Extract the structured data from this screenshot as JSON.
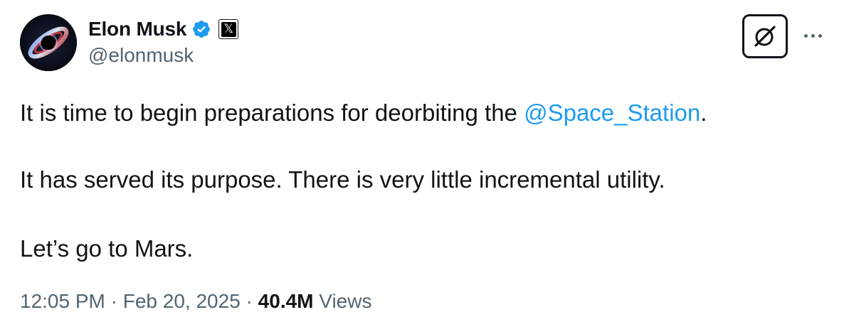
{
  "author": {
    "display_name": "Elon Musk",
    "handle": "@elonmusk",
    "verified": true,
    "verified_color": "#1d9bf0",
    "affiliation_badge": "𝕏"
  },
  "tweet": {
    "line1_text": "It is time to begin preparations for deorbiting the ",
    "line1_mention": "@Space_Station",
    "line1_end": ".",
    "line2": "It has served its purpose. There is very little incremental utility.",
    "line3": "Let’s go to Mars."
  },
  "meta": {
    "time": "12:05 PM",
    "separator": " · ",
    "date": "Feb 20, 2025",
    "views_count": "40.4M",
    "views_label": "Views"
  },
  "icons": {
    "grok": "grok-icon",
    "more": "more-icon"
  },
  "colors": {
    "link": "#1d9bf0",
    "text": "#0f1419",
    "secondary": "#536471"
  }
}
